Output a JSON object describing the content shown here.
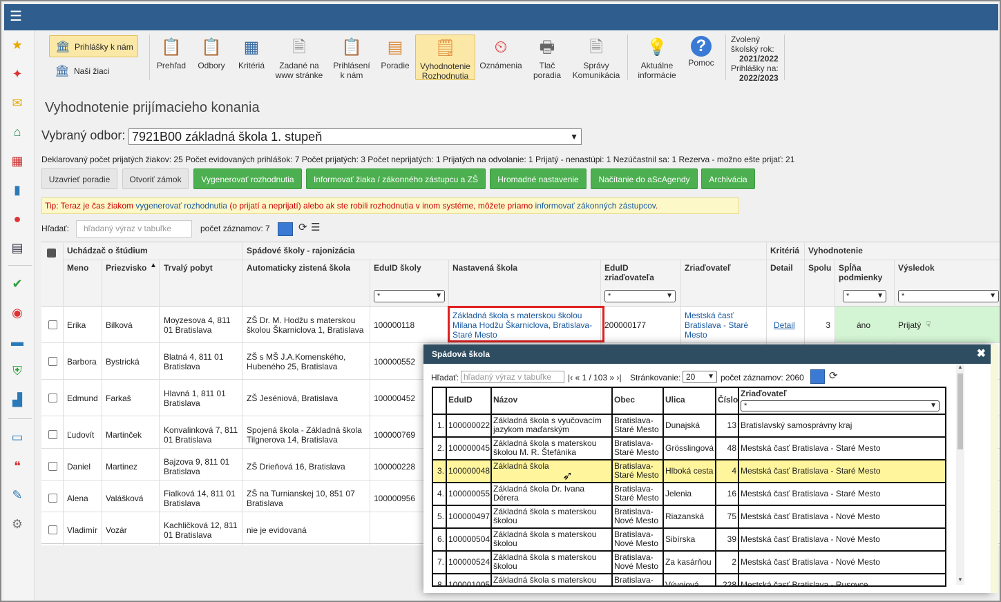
{
  "toolbar": {
    "left_buttons": [
      "Prihlášky k nám",
      "Naši žiaci"
    ],
    "items": [
      {
        "l1": "Prehľad",
        "l2": "",
        "icon": "clipboard-eye-icon"
      },
      {
        "l1": "Odbory",
        "l2": "",
        "icon": "clipboard-search-icon"
      },
      {
        "l1": "Kritériá",
        "l2": "",
        "icon": "calculator-icon"
      },
      {
        "l1": "Zadané na",
        "l2": "www stránke",
        "icon": "document-icon"
      },
      {
        "l1": "Prihlásení",
        "l2": "k nám",
        "icon": "clipboard-check-icon"
      },
      {
        "l1": "Poradie",
        "l2": "",
        "icon": "ranking-icon"
      },
      {
        "l1": "Vyhodnotenie",
        "l2": "Rozhodnutia",
        "icon": "certificate-icon"
      },
      {
        "l1": "Oznámenia",
        "l2": "",
        "icon": "clock-alarm-icon"
      },
      {
        "l1": "Tlač",
        "l2": "poradia",
        "icon": "printer-icon"
      },
      {
        "l1": "Správy",
        "l2": "Komunikácia",
        "icon": "message-doc-icon"
      },
      {
        "l1": "Aktuálne",
        "l2": "informácie",
        "icon": "lightbulb-icon"
      },
      {
        "l1": "Pomoc",
        "l2": "",
        "icon": "help-icon"
      }
    ],
    "year": {
      "l1": "Zvolený",
      "l2": "školský rok:",
      "v1": "2021/2022",
      "l3": "Prihlášky na:",
      "v2": "2022/2023"
    }
  },
  "page": {
    "title": "Vyhodnotenie prijímacieho konania",
    "odbor_label": "Vybraný odbor:",
    "odbor_value": "7921B00 základná škola 1. stupeň",
    "stats": "Deklarovaný počet prijatých žiakov: 25 Počet evidovaných prihlášok: 7 Počet prijatých: 3 Počet neprijatých: 1 Prijatých na odvolanie: 1 Prijatý - nenastúpi: 1 Nezúčastnil sa: 1 Rezerva - možno ešte prijať: 21",
    "buttons": [
      "Uzavrieť poradie",
      "Otvoriť zámok",
      "Vygenerovať rozhodnutia",
      "Informovať žiaka / zákonného zástupcu a ZŠ",
      "Hromadné nastavenie",
      "Načítanie do aScAgendy",
      "Archivácia"
    ],
    "tip_prefix": "Tip: Teraz je čas žiakom ",
    "tip_link1": "vygenerovať rozhodnutia",
    "tip_mid": " (o prijatí a neprijatí) alebo ak ste robili rozhodnutia v inom systéme, môžete priamo ",
    "tip_link2": "informovať zákonných zástupcov",
    "tip_end": ".",
    "search_label": "Hľadať:",
    "search_placeholder": "hľadaný výraz v tabuľke",
    "count_label": "počet záznamov: 7"
  },
  "table": {
    "group_headers": [
      "Uchádzač o štúdium",
      "Spádové školy - rajonizácia",
      "Kritériá",
      "Vyhodnotenie"
    ],
    "headers": [
      "Meno",
      "Priezvisko",
      "Trvalý pobyt",
      "Automaticky zistená škola",
      "EduID školy",
      "Nastavená škola",
      "EduID zriaďovateľa",
      "Zriaďovateľ",
      "Detail",
      "Spolu",
      "Spĺňa podmienky",
      "Výsledok"
    ],
    "filter": "*",
    "rows": [
      {
        "meno": "Erika",
        "priezvisko": "Bilková",
        "pobyt": "Moyzesova 4, 811 01 Bratislava",
        "auto": "ZŠ Dr. M. Hodžu s materskou školou Škarniclova 1, Bratislava",
        "eduid": "100000118",
        "nastavena": "Základná škola s materskou školou Milana Hodžu Škarniclova, Bratislava-Staré Mesto",
        "eduz": "200000177",
        "zriad": "Mestská časť Bratislava - Staré Mesto",
        "detail": "Detail",
        "spolu": "3",
        "splna": "áno",
        "vysledok": "Prijatý"
      },
      {
        "meno": "Barbora",
        "priezvisko": "Bystrická",
        "pobyt": "Blatná 4, 811 01 Bratislava",
        "auto": "ZŠ s MŠ J.A.Komenského, Hubeného 25, Bratislava",
        "eduid": "100000552"
      },
      {
        "meno": "Edmund",
        "priezvisko": "Farkaš",
        "pobyt": "Hlavná 1, 811 01 Bratislava",
        "auto": "ZŠ Jeséniová, Bratislava",
        "eduid": "100000452"
      },
      {
        "meno": "Ľudovít",
        "priezvisko": "Martinček",
        "pobyt": "Konvalinková 7, 811 01 Bratislava",
        "auto": "Spojená škola - Základná škola Tilgnerova 14, Bratislava",
        "eduid": "100000769"
      },
      {
        "meno": "Daniel",
        "priezvisko": "Martinez",
        "pobyt": "Bajzova 9, 811 01 Bratislava",
        "auto": "ZŠ Drieňová 16, Bratislava",
        "eduid": "100000228"
      },
      {
        "meno": "Alena",
        "priezvisko": "Valášková",
        "pobyt": "Fialková 14, 811 01 Bratislava",
        "auto": "ZŠ na Turnianskej 10, 851 07 Bratislava",
        "eduid": "100000956"
      },
      {
        "meno": "Vladimír",
        "priezvisko": "Vozár",
        "pobyt": "Kachličková 12, 811 01 Bratislava",
        "auto": "nie je evidovaná",
        "eduid": ""
      }
    ]
  },
  "modal": {
    "title": "Spádová škola",
    "search_label": "Hľadať:",
    "search_placeholder": "hľadaný výraz v tabuľke",
    "pager": "|‹ « 1 / 103 » ›|",
    "paging_label": "Stránkovanie:",
    "paging_value": "20",
    "count_label": "počet záznamov: 2060",
    "headers": [
      "EduID",
      "Názov",
      "Obec",
      "Ulica",
      "Číslo",
      "Zriaďovateľ"
    ],
    "filter": "*",
    "rows": [
      {
        "n": "1.",
        "id": "100000022",
        "nazov": "Základná škola s vyučovacím jazykom maďarským",
        "obec": "Bratislava-Staré Mesto",
        "ulica": "Dunajská",
        "cislo": "13",
        "zriad": "Bratislavský samosprávny kraj"
      },
      {
        "n": "2.",
        "id": "100000045",
        "nazov": "Základná škola s materskou školou M. R. Štefánika",
        "obec": "Bratislava-Staré Mesto",
        "ulica": "Grösslingová",
        "cislo": "48",
        "zriad": "Mestská časť Bratislava - Staré Mesto"
      },
      {
        "n": "3.",
        "id": "100000048",
        "nazov": "Základná škola",
        "obec": "Bratislava-Staré Mesto",
        "ulica": "Hlboká cesta",
        "cislo": "4",
        "zriad": "Mestská časť Bratislava - Staré Mesto"
      },
      {
        "n": "4.",
        "id": "100000055",
        "nazov": "Základná škola Dr. Ivana Dérera",
        "obec": "Bratislava-Staré Mesto",
        "ulica": "Jelenia",
        "cislo": "16",
        "zriad": "Mestská časť Bratislava - Staré Mesto"
      },
      {
        "n": "5.",
        "id": "100000497",
        "nazov": "Základná škola s materskou školou",
        "obec": "Bratislava-Nové Mesto",
        "ulica": "Riazanská",
        "cislo": "75",
        "zriad": "Mestská časť Bratislava - Nové Mesto"
      },
      {
        "n": "6.",
        "id": "100000504",
        "nazov": "Základná škola s materskou školou",
        "obec": "Bratislava-Nové Mesto",
        "ulica": "Sibírska",
        "cislo": "39",
        "zriad": "Mestská časť Bratislava - Nové Mesto"
      },
      {
        "n": "7.",
        "id": "100000524",
        "nazov": "Základná škola s materskou školou",
        "obec": "Bratislava-Nové Mesto",
        "ulica": "Za kasárňou",
        "cislo": "2",
        "zriad": "Mestská časť Bratislava - Nové Mesto"
      },
      {
        "n": "8.",
        "id": "100001005",
        "nazov": "Základná škola s materskou",
        "obec": "Bratislava-",
        "ulica": "Vývojová",
        "cislo": "228",
        "zriad": "Mestská časť Bratislava - Rusovce"
      }
    ]
  },
  "colors": {
    "topbar": "#2f5e8e",
    "green": "#4caf50",
    "highlight": "#fff59d",
    "modal_head": "#2f4d61"
  }
}
